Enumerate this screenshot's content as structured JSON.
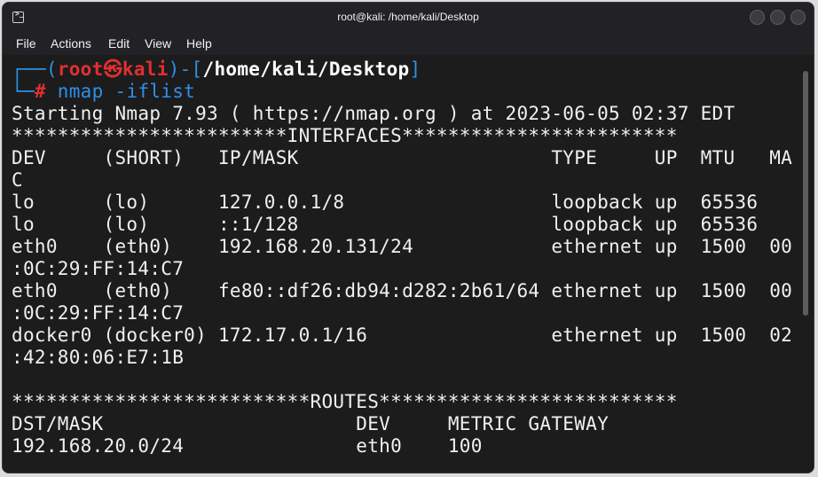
{
  "window": {
    "title": "root@kali: /home/kali/Desktop"
  },
  "menu": [
    "File",
    "Actions",
    "Edit",
    "View",
    "Help"
  ],
  "prompt": {
    "top_left": "┌──(",
    "user": "root",
    "at_symbol": "㉿",
    "host": "kali",
    "mid": ")-[",
    "path": "/home/kali/Desktop",
    "close": "]",
    "bottom_left": "└─",
    "hash": "#",
    "command": " nmap -iflist"
  },
  "output": [
    "Starting Nmap 7.93 ( https://nmap.org ) at 2023-06-05 02:37 EDT",
    "************************INTERFACES************************",
    "DEV     (SHORT)   IP/MASK                      TYPE     UP  MTU   MA",
    "C",
    "lo      (lo)      127.0.0.1/8                  loopback up  65536",
    "lo      (lo)      ::1/128                      loopback up  65536",
    "eth0    (eth0)    192.168.20.131/24            ethernet up  1500  00",
    ":0C:29:FF:14:C7",
    "eth0    (eth0)    fe80::df26:db94:d282:2b61/64 ethernet up  1500  00",
    ":0C:29:FF:14:C7",
    "docker0 (docker0) 172.17.0.1/16                ethernet up  1500  02",
    ":42:80:06:E7:1B",
    "",
    "**************************ROUTES**************************",
    "DST/MASK                      DEV     METRIC GATEWAY",
    "192.168.20.0/24               eth0    100"
  ]
}
